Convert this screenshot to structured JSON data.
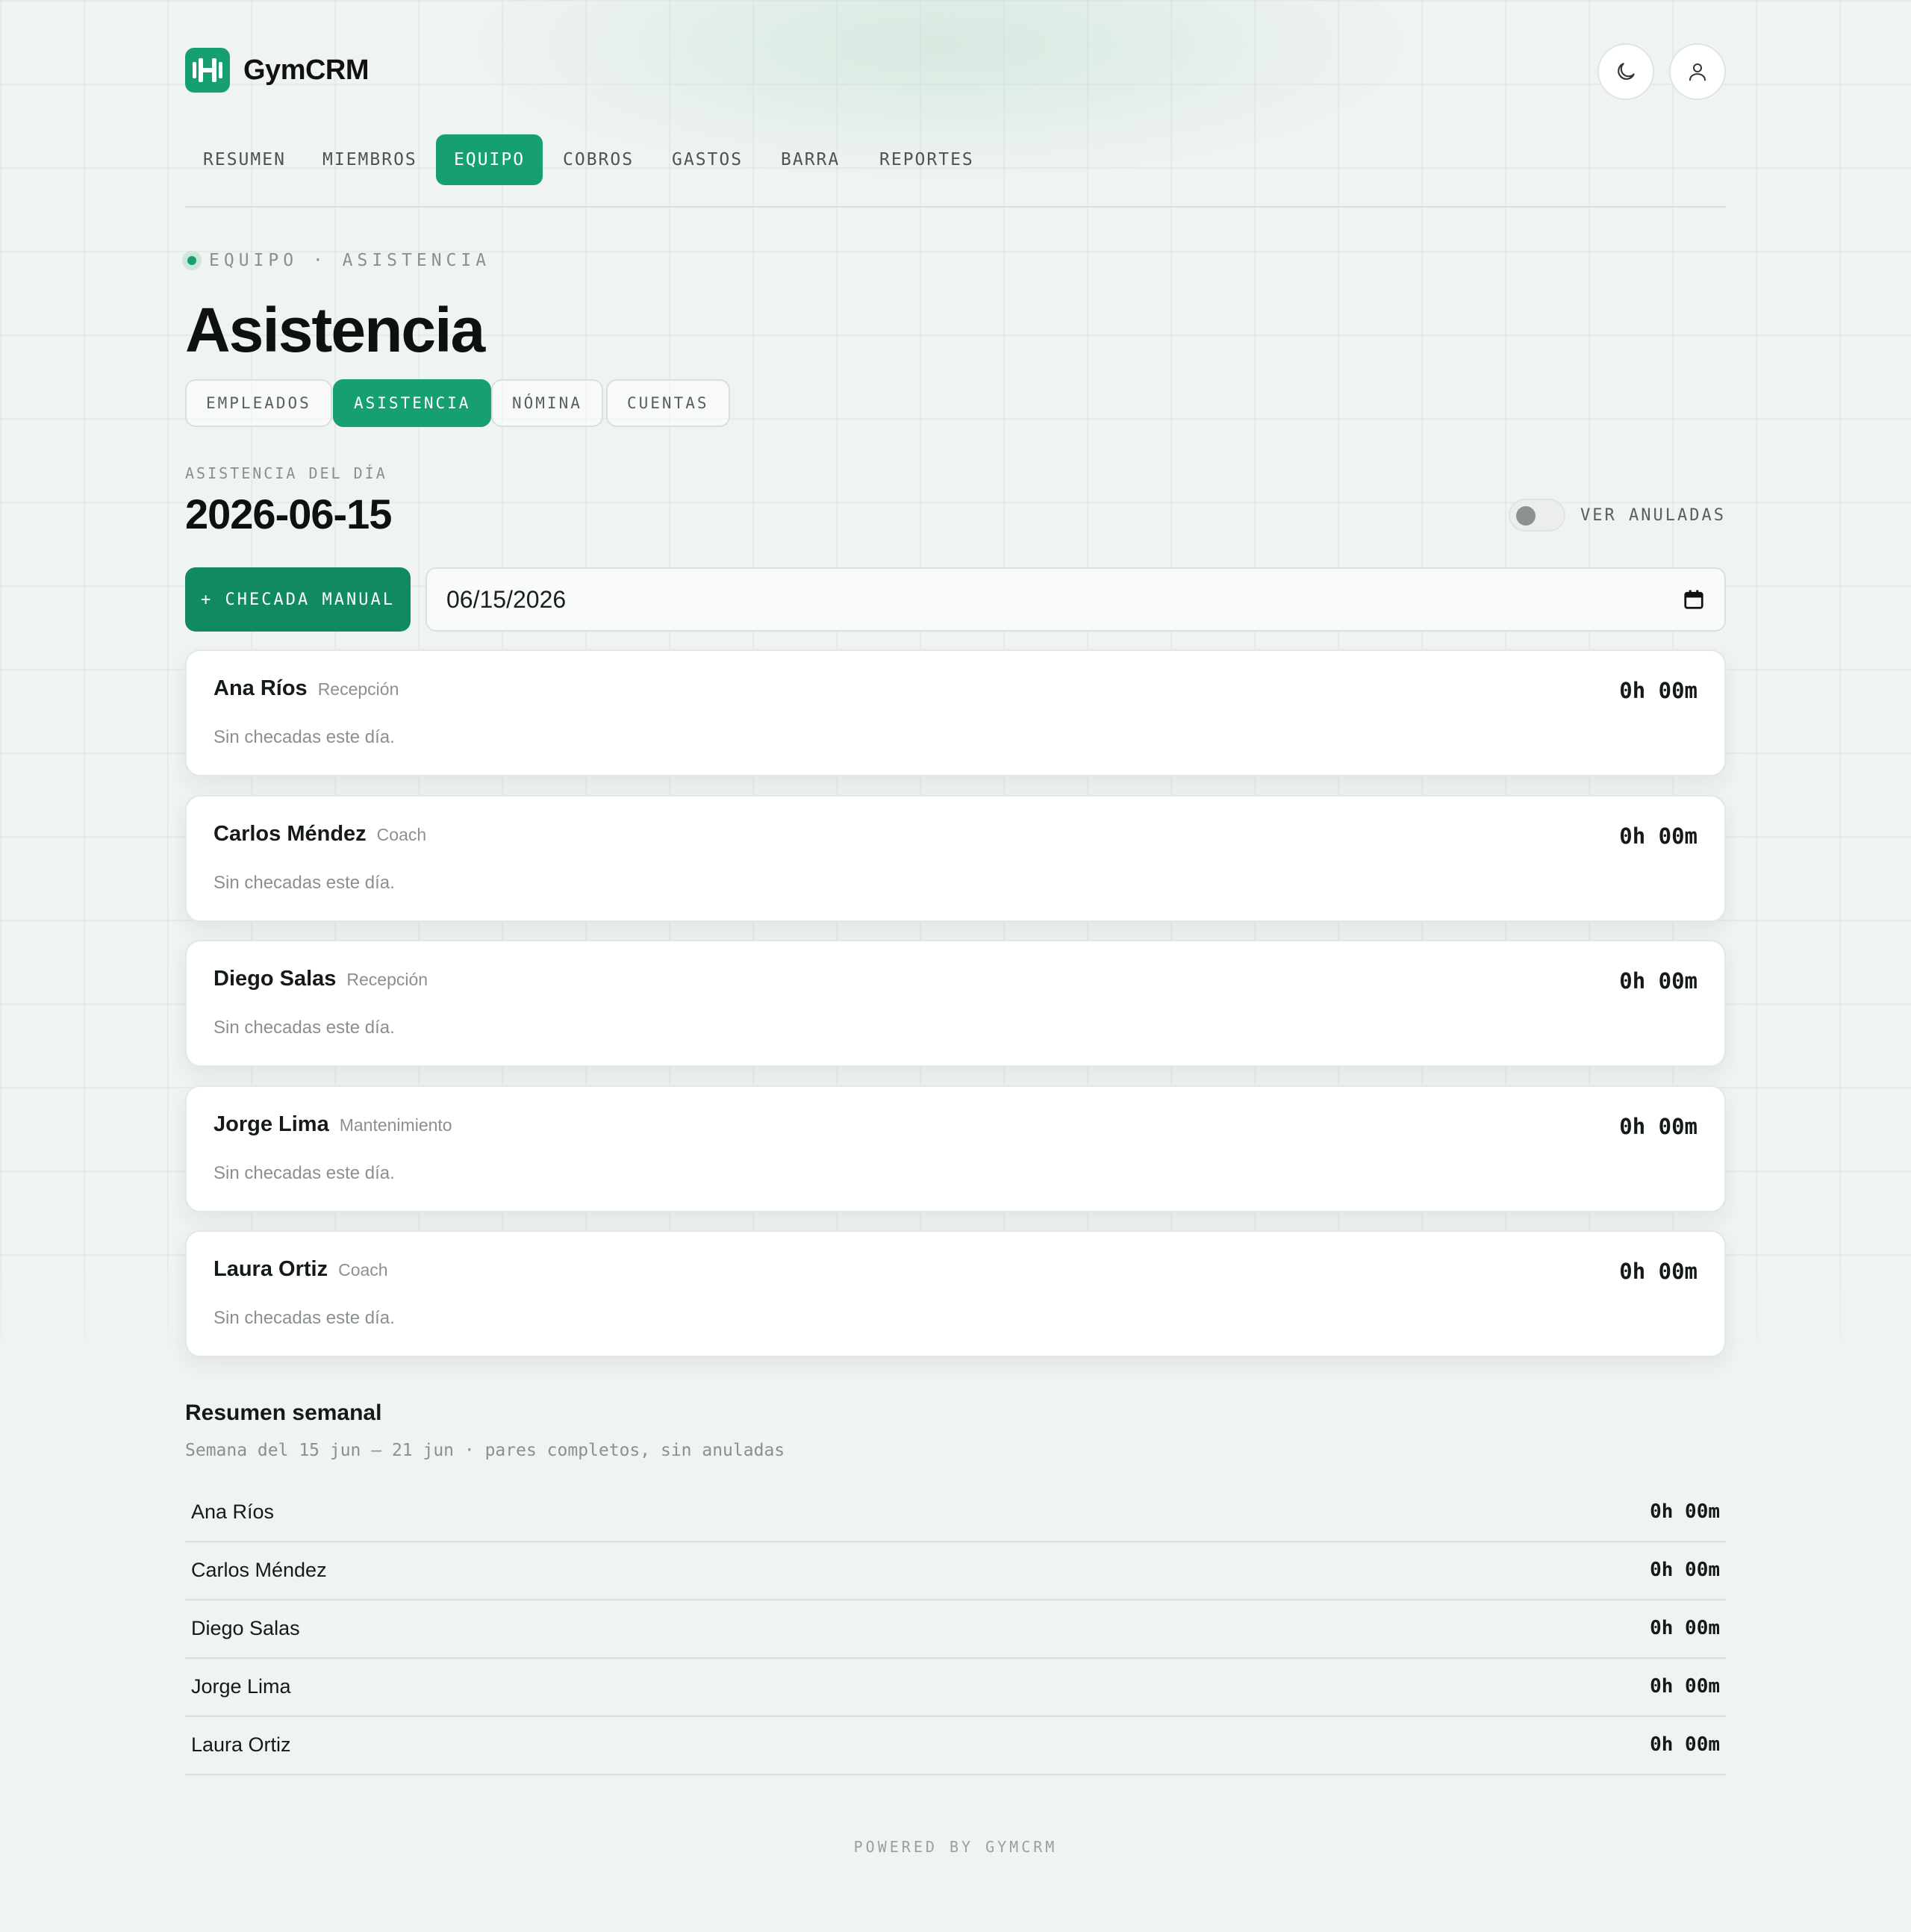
{
  "app": {
    "name": "GymCRM"
  },
  "header": {
    "theme_icon": "moon-icon",
    "user_icon": "user-icon"
  },
  "nav": {
    "items": [
      {
        "label": "RESUMEN",
        "active": false
      },
      {
        "label": "MIEMBROS",
        "active": false
      },
      {
        "label": "EQUIPO",
        "active": true
      },
      {
        "label": "COBROS",
        "active": false
      },
      {
        "label": "GASTOS",
        "active": false
      },
      {
        "label": "BARRA",
        "active": false
      },
      {
        "label": "REPORTES",
        "active": false
      }
    ]
  },
  "page": {
    "breadcrumb": "EQUIPO · ASISTENCIA",
    "title": "Asistencia"
  },
  "subtabs": [
    {
      "label": "EMPLEADOS",
      "active": false
    },
    {
      "label": "ASISTENCIA",
      "active": true
    },
    {
      "label": "NÓMINA",
      "active": false
    },
    {
      "label": "CUENTAS",
      "active": false
    }
  ],
  "attendance": {
    "section_label": "ASISTENCIA DEL DÍA",
    "date": "2026-06-15",
    "toggle_label": "VER ANULADAS",
    "toggle_on": false,
    "manual_button": "+ CHECADA MANUAL",
    "date_input_value": "06/15/2026",
    "employees": [
      {
        "name": "Ana Ríos",
        "role": "Recepción",
        "hours": "0h 00m",
        "empty": "Sin checadas este día."
      },
      {
        "name": "Carlos Méndez",
        "role": "Coach",
        "hours": "0h 00m",
        "empty": "Sin checadas este día."
      },
      {
        "name": "Diego Salas",
        "role": "Recepción",
        "hours": "0h 00m",
        "empty": "Sin checadas este día."
      },
      {
        "name": "Jorge Lima",
        "role": "Mantenimiento",
        "hours": "0h 00m",
        "empty": "Sin checadas este día."
      },
      {
        "name": "Laura Ortiz",
        "role": "Coach",
        "hours": "0h 00m",
        "empty": "Sin checadas este día."
      }
    ]
  },
  "weekly": {
    "title": "Resumen semanal",
    "subtitle": "Semana del 15 jun — 21 jun · pares completos, sin anuladas",
    "rows": [
      {
        "name": "Ana Ríos",
        "hours": "0h 00m"
      },
      {
        "name": "Carlos Méndez",
        "hours": "0h 00m"
      },
      {
        "name": "Diego Salas",
        "hours": "0h 00m"
      },
      {
        "name": "Jorge Lima",
        "hours": "0h 00m"
      },
      {
        "name": "Laura Ortiz",
        "hours": "0h 00m"
      }
    ]
  },
  "footer": {
    "text": "POWERED BY GYMCRM"
  },
  "colors": {
    "accent": "#17a06f",
    "accent_dark": "#128a5f",
    "background": "#eff3f1"
  }
}
